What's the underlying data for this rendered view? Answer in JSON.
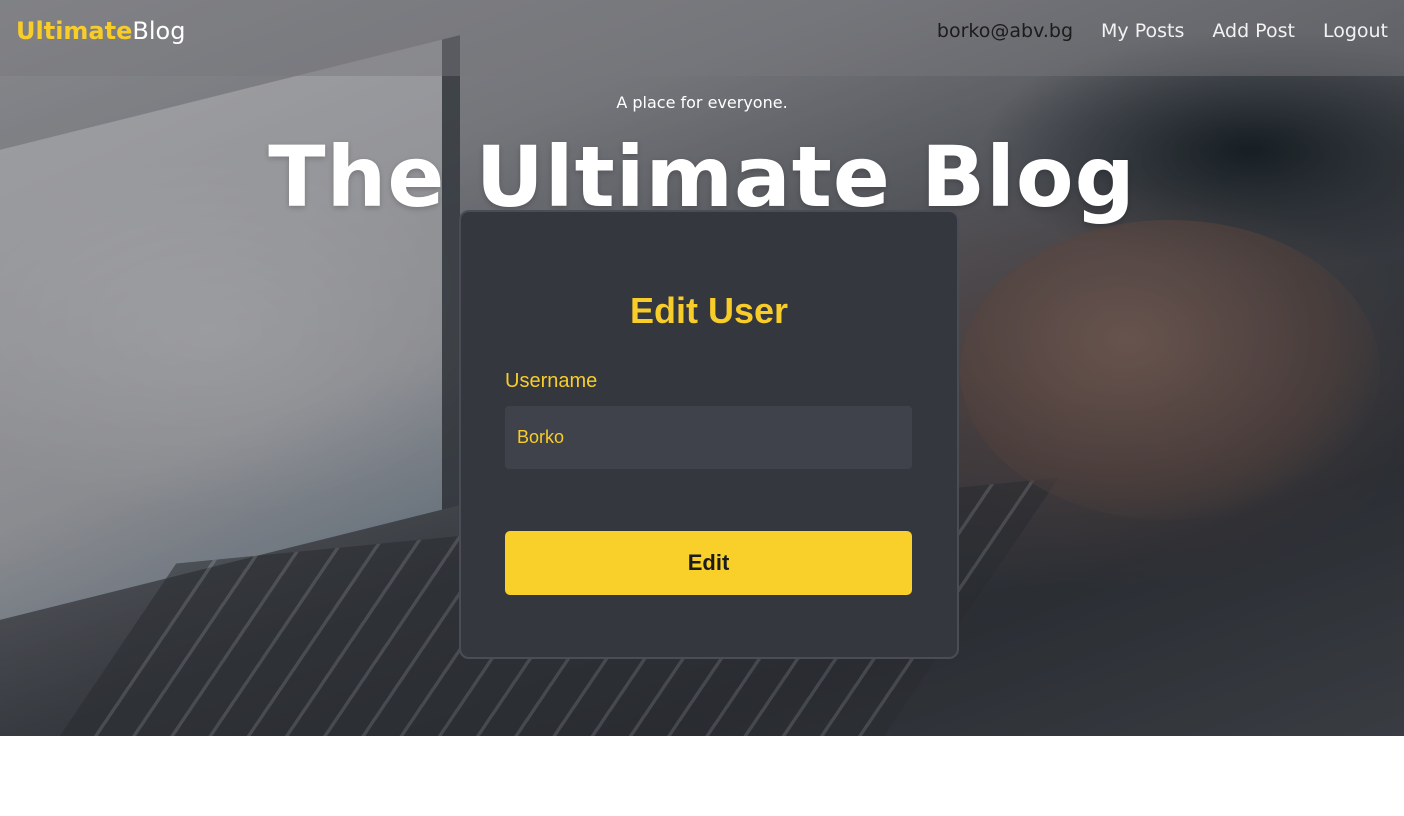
{
  "navbar": {
    "brand_accent": "Ultimate",
    "brand_rest": "Blog",
    "user_email": "borko@abv.bg",
    "links": [
      "My Posts",
      "Add Post",
      "Logout"
    ]
  },
  "hero": {
    "tagline": "A place for everyone.",
    "title": "The Ultimate Blog"
  },
  "form": {
    "title": "Edit User",
    "username_label": "Username",
    "username_value": "Borko",
    "submit_label": "Edit"
  },
  "colors": {
    "accent": "#f8cd2a",
    "card_background": "#34373e",
    "input_background": "#3f424a"
  }
}
